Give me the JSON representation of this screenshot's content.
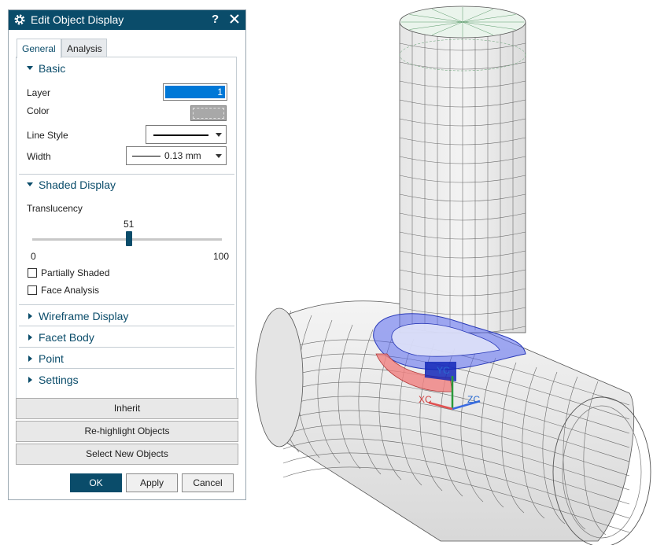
{
  "dialog": {
    "title": "Edit Object Display",
    "help": "?",
    "tabs": [
      {
        "label": "General",
        "active": true
      },
      {
        "label": "Analysis",
        "active": false
      }
    ],
    "groups": {
      "basic": {
        "label": "Basic",
        "expanded": true,
        "layer_label": "Layer",
        "layer_value": "1",
        "color_label": "Color",
        "color_value": "#a8a8a8",
        "line_style_label": "Line Style",
        "width_label": "Width",
        "width_value": "0.13 mm"
      },
      "shaded": {
        "label": "Shaded Display",
        "expanded": true,
        "translucency_label": "Translucency",
        "translucency_value": "51",
        "slider_min": "0",
        "slider_max": "100",
        "partially_shaded_label": "Partially Shaded",
        "partially_shaded_checked": false,
        "face_analysis_label": "Face Analysis",
        "face_analysis_checked": false
      },
      "collapsed": [
        {
          "label": "Wireframe Display"
        },
        {
          "label": "Facet Body"
        },
        {
          "label": "Point"
        },
        {
          "label": "Settings"
        }
      ]
    },
    "buttons": {
      "inherit": "Inherit",
      "rehighlight": "Re-highlight Objects",
      "select_new": "Select New Objects",
      "ok": "OK",
      "apply": "Apply",
      "cancel": "Cancel"
    }
  },
  "viewport": {
    "triad": {
      "xc": "XC",
      "yc": "YC",
      "zc": "ZC"
    }
  },
  "colors": {
    "titlebar": "#0a4c6a",
    "accent": "#0a4c6a",
    "highlight_blue": "#3a4ee8",
    "highlight_red": "#e86a6a"
  }
}
